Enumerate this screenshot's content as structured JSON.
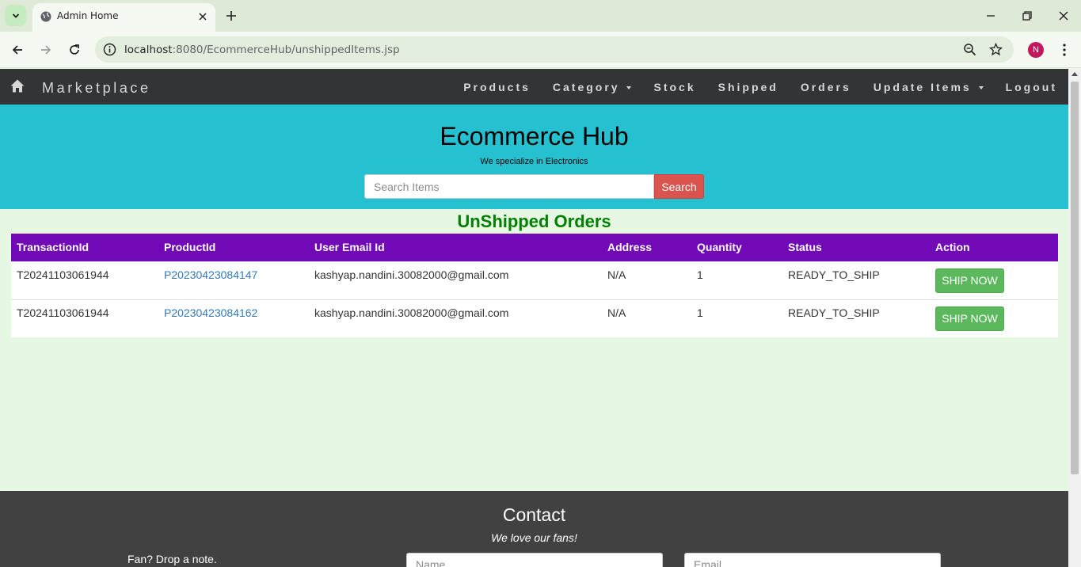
{
  "browser": {
    "tab_title": "Admin Home",
    "url_host": "localhost",
    "url_rest": ":8080/EcommerceHub/unshippedItems.jsp",
    "profile_initial": "N"
  },
  "navbar": {
    "brand": "Marketplace",
    "items": [
      {
        "label": "Products",
        "dropdown": false
      },
      {
        "label": "Category",
        "dropdown": true
      },
      {
        "label": "Stock",
        "dropdown": false
      },
      {
        "label": "Shipped",
        "dropdown": false
      },
      {
        "label": "Orders",
        "dropdown": false
      },
      {
        "label": "Update Items",
        "dropdown": true
      },
      {
        "label": "Logout",
        "dropdown": false
      }
    ]
  },
  "hero": {
    "title": "Ecommerce Hub",
    "subtitle": "We specialize in Electronics",
    "search_placeholder": "Search Items",
    "search_button": "Search"
  },
  "orders": {
    "title": "UnShipped Orders",
    "columns": [
      "TransactionId",
      "ProductId",
      "User Email Id",
      "Address",
      "Quantity",
      "Status",
      "Action"
    ],
    "rows": [
      {
        "transaction_id": "T20241103061944",
        "product_id": "P20230423084147",
        "email": "kashyap.nandini.30082000@gmail.com",
        "address": "N/A",
        "quantity": "1",
        "status": "READY_TO_SHIP",
        "action": "SHIP NOW"
      },
      {
        "transaction_id": "T20241103061944",
        "product_id": "P20230423084162",
        "email": "kashyap.nandini.30082000@gmail.com",
        "address": "N/A",
        "quantity": "1",
        "status": "READY_TO_SHIP",
        "action": "SHIP NOW"
      }
    ]
  },
  "footer": {
    "title": "Contact",
    "tagline": "We love our fans!",
    "note": "Fan? Drop a note.",
    "name_placeholder": "Name",
    "email_placeholder": "Email"
  },
  "colors": {
    "navbar": "#333436",
    "hero": "#26c1d0",
    "table_header": "#7209b7",
    "section_title": "#008000",
    "ship_button": "#5cb85c",
    "search_button": "#d9534f"
  }
}
